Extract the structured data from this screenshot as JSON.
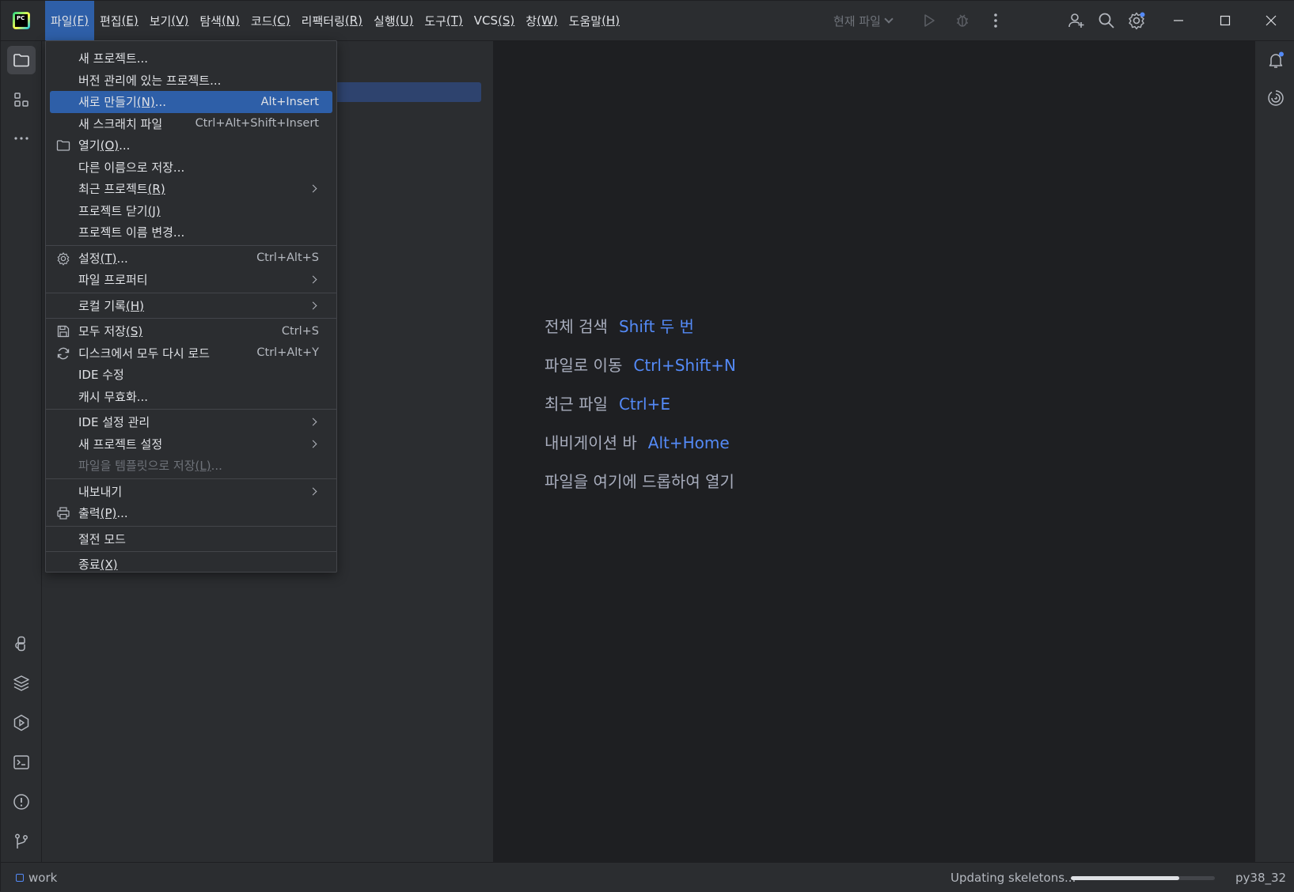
{
  "app": {
    "logo_text": "PC"
  },
  "menubar": [
    {
      "label": "파일",
      "mnemonic": "(F)",
      "active": true
    },
    {
      "label": "편집",
      "mnemonic": "(E)"
    },
    {
      "label": "보기",
      "mnemonic": "(V)"
    },
    {
      "label": "탐색",
      "mnemonic": "(N)"
    },
    {
      "label": "코드",
      "mnemonic": "(C)"
    },
    {
      "label": "리팩터링",
      "mnemonic": "(R)"
    },
    {
      "label": "실행",
      "mnemonic": "(U)"
    },
    {
      "label": "도구",
      "mnemonic": "(T)"
    },
    {
      "label": "VCS",
      "mnemonic": "(S)"
    },
    {
      "label": "창",
      "mnemonic": "(W)"
    },
    {
      "label": "도움말",
      "mnemonic": "(H)"
    }
  ],
  "toolbar": {
    "current_file_label": "현재 파일",
    "icons": [
      "run-icon",
      "debug-icon",
      "more-vertical-icon",
      "add-user-icon",
      "search-icon",
      "settings-icon",
      "minimize-icon",
      "maximize-icon",
      "close-icon"
    ]
  },
  "file_menu": {
    "groups": [
      [
        {
          "label": "새 프로젝트...",
          "shortcut": ""
        },
        {
          "label": "버전 관리에 있는 프로젝트...",
          "shortcut": ""
        },
        {
          "label": "새로 만들기",
          "mnemonic": "(N)",
          "suffix": "...",
          "shortcut": "Alt+Insert",
          "highlighted": true
        },
        {
          "label": "새 스크래치 파일",
          "shortcut": "Ctrl+Alt+Shift+Insert"
        },
        {
          "label": "열기",
          "mnemonic": "(O)",
          "suffix": "...",
          "icon": "folder-icon"
        },
        {
          "label": "다른 이름으로 저장...",
          "shortcut": ""
        },
        {
          "label": "최근 프로젝트",
          "mnemonic": "(R)",
          "submenu": true
        },
        {
          "label": "프로젝트 닫기",
          "mnemonic": "(J)"
        },
        {
          "label": "프로젝트 이름 변경...",
          "shortcut": ""
        }
      ],
      [
        {
          "label": "설정",
          "mnemonic": "(T)",
          "suffix": "...",
          "shortcut": "Ctrl+Alt+S",
          "icon": "gear-icon"
        },
        {
          "label": "파일 프로퍼티",
          "submenu": true
        }
      ],
      [
        {
          "label": "로컬 기록",
          "mnemonic": "(H)",
          "submenu": true
        }
      ],
      [
        {
          "label": "모두 저장",
          "mnemonic": "(S)",
          "shortcut": "Ctrl+S",
          "icon": "save-icon"
        },
        {
          "label": "디스크에서 모두 다시 로드",
          "shortcut": "Ctrl+Alt+Y",
          "icon": "reload-icon"
        },
        {
          "label": "IDE 수정",
          "shortcut": ""
        },
        {
          "label": "캐시 무효화...",
          "shortcut": ""
        }
      ],
      [
        {
          "label": "IDE 설정 관리",
          "submenu": true
        },
        {
          "label": "새 프로젝트 설정",
          "submenu": true
        },
        {
          "label": "파일을 템플릿으로 저장",
          "mnemonic": "(L)",
          "suffix": "...",
          "disabled": true
        }
      ],
      [
        {
          "label": "내보내기",
          "submenu": true
        },
        {
          "label": "출력",
          "mnemonic": "(P)",
          "suffix": "...",
          "icon": "print-icon"
        }
      ],
      [
        {
          "label": "절전 모드",
          "shortcut": ""
        }
      ],
      [
        {
          "label": "종료",
          "mnemonic": "(X)"
        }
      ]
    ]
  },
  "editor_hints": [
    {
      "label": "전체 검색",
      "key": "Shift 두 번"
    },
    {
      "label": "파일로 이동",
      "key": "Ctrl+Shift+N"
    },
    {
      "label": "최근 파일",
      "key": "Ctrl+E"
    },
    {
      "label": "내비게이션 바",
      "key": "Alt+Home"
    },
    {
      "label": "파일을 여기에 드롭하여 열기",
      "key": ""
    }
  ],
  "statusbar": {
    "project": "work",
    "progress_label": "Updating skeletons...",
    "progress_fraction": 0.75,
    "interpreter": "py38_32"
  },
  "colors": {
    "accent": "#2e5fa8",
    "link": "#548af7",
    "notification_dot": "#548af7"
  }
}
